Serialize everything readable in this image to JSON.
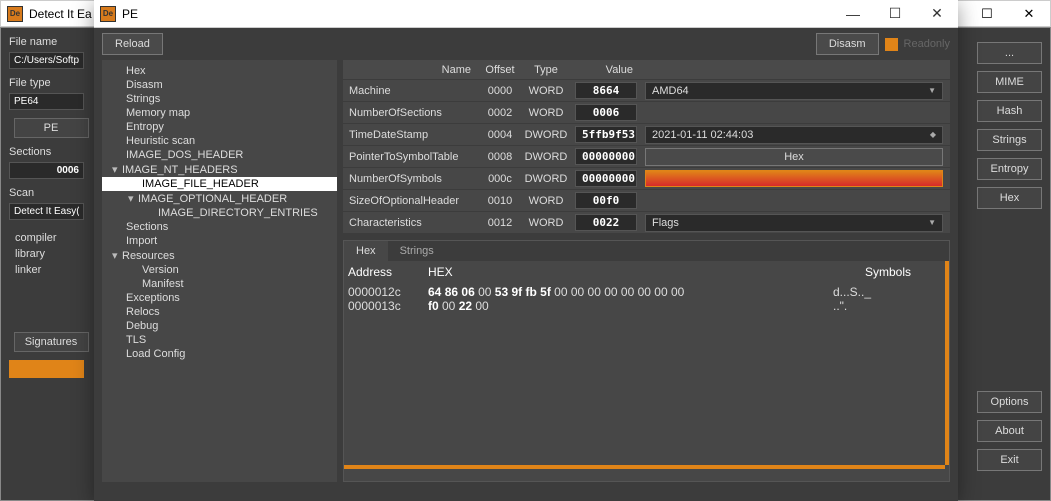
{
  "bg": {
    "title": "Detect It Ea",
    "filename_label": "File name",
    "filename_value": "C:/Users/Softpe",
    "filetype_label": "File type",
    "filetype_value": "PE64",
    "pe_btn": "PE",
    "sections_label": "Sections",
    "sections_value": "0006",
    "scan_label": "Scan",
    "scan_value": "Detect It Easy(",
    "list": [
      "compiler",
      "library",
      "linker"
    ],
    "signatures_btn": "Signatures",
    "right_btns": [
      "...",
      "MIME",
      "Hash",
      "Strings",
      "Entropy",
      "Hex",
      "Options",
      "About",
      "Exit"
    ]
  },
  "fg": {
    "title": "PE",
    "reload": "Reload",
    "disasm": "Disasm",
    "readonly": "Readonly",
    "tree": [
      {
        "t": "Hex",
        "i": 1
      },
      {
        "t": "Disasm",
        "i": 1
      },
      {
        "t": "Strings",
        "i": 1
      },
      {
        "t": "Memory map",
        "i": 1
      },
      {
        "t": "Entropy",
        "i": 1
      },
      {
        "t": "Heuristic scan",
        "i": 1
      },
      {
        "t": "IMAGE_DOS_HEADER",
        "i": 1
      },
      {
        "t": "IMAGE_NT_HEADERS",
        "i": 1,
        "exp": "▾"
      },
      {
        "t": "IMAGE_FILE_HEADER",
        "i": 2,
        "sel": true
      },
      {
        "t": "IMAGE_OPTIONAL_HEADER",
        "i": 2,
        "exp": "▾"
      },
      {
        "t": "IMAGE_DIRECTORY_ENTRIES",
        "i": 3
      },
      {
        "t": "Sections",
        "i": 1
      },
      {
        "t": "Import",
        "i": 1
      },
      {
        "t": "Resources",
        "i": 1,
        "exp": "▾"
      },
      {
        "t": "Version",
        "i": 2
      },
      {
        "t": "Manifest",
        "i": 2
      },
      {
        "t": "Exceptions",
        "i": 1
      },
      {
        "t": "Relocs",
        "i": 1
      },
      {
        "t": "Debug",
        "i": 1
      },
      {
        "t": "TLS",
        "i": 1
      },
      {
        "t": "Load Config",
        "i": 1
      }
    ],
    "table": {
      "hdr": {
        "name": "Name",
        "offset": "Offset",
        "type": "Type",
        "value": "Value"
      },
      "rows": [
        {
          "name": "Machine",
          "offset": "0000",
          "type": "WORD",
          "value": "8664",
          "extra": {
            "kind": "combo",
            "text": "AMD64"
          }
        },
        {
          "name": "NumberOfSections",
          "offset": "0002",
          "type": "WORD",
          "value": "0006"
        },
        {
          "name": "TimeDateStamp",
          "offset": "0004",
          "type": "DWORD",
          "value": "5ffb9f53",
          "extra": {
            "kind": "date",
            "text": "2021-01-11 02:44:03"
          }
        },
        {
          "name": "PointerToSymbolTable",
          "offset": "0008",
          "type": "DWORD",
          "value": "00000000",
          "extra": {
            "kind": "hexbtn",
            "text": "Hex"
          }
        },
        {
          "name": "NumberOfSymbols",
          "offset": "000c",
          "type": "DWORD",
          "value": "00000000",
          "extra": {
            "kind": "red"
          }
        },
        {
          "name": "SizeOfOptionalHeader",
          "offset": "0010",
          "type": "WORD",
          "value": "00f0"
        },
        {
          "name": "Characteristics",
          "offset": "0012",
          "type": "WORD",
          "value": "0022",
          "extra": {
            "kind": "combo",
            "text": "Flags"
          }
        }
      ]
    },
    "hex": {
      "tabs": [
        "Hex",
        "Strings"
      ],
      "hdr": {
        "addr": "Address",
        "hex": "HEX",
        "sym": "Symbols"
      },
      "rows": [
        {
          "a": "0000012c",
          "h": "64 86 06 00 53 9f fb 5f 00 00 00 00 00 00 00 00",
          "s": "d...S.._"
        },
        {
          "a": "0000013c",
          "h": "f0 00 22 00",
          "s": "..\"."
        }
      ]
    }
  }
}
